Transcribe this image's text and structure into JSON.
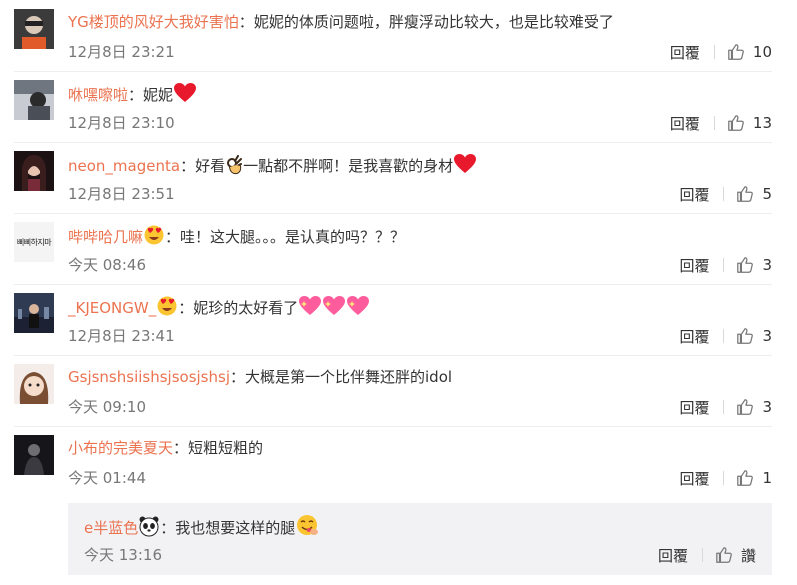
{
  "comments": [
    {
      "username": "YG楼顶的风好大我好害怕",
      "text": "妮妮的体质问题啦，胖瘦浮动比较大，也是比较难受了",
      "time": "12月8日 23:21",
      "reply_label": "回覆",
      "likes": "10"
    },
    {
      "username": "咻嘿嚓啦",
      "text": "妮妮",
      "time": "12月8日 23:10",
      "reply_label": "回覆",
      "likes": "13"
    },
    {
      "username": "neon_magenta",
      "text": "好看",
      "text2": "一點都不胖啊！是我喜歡的身材",
      "time": "12月8日 23:51",
      "reply_label": "回覆",
      "likes": "5"
    },
    {
      "username": "哔哔哈几嘛",
      "text": "哇！这大腿。。。是认真的吗？？？",
      "time": "今天 08:46",
      "reply_label": "回覆",
      "likes": "3"
    },
    {
      "username": "_KJEONGW_",
      "text": "妮珍的太好看了",
      "time": "12月8日 23:41",
      "reply_label": "回覆",
      "likes": "3"
    },
    {
      "username": "Gsjsnshsiishsjsosjshsj",
      "text": "大概是第一个比伴舞还胖的idol",
      "time": "今天 09:10",
      "reply_label": "回覆",
      "likes": "3"
    },
    {
      "username": "小布的完美夏天",
      "text": "短粗短粗的",
      "time": "今天 01:44",
      "reply_label": "回覆",
      "likes": "1"
    }
  ],
  "subreply": {
    "username": "e半蓝色",
    "text": "我也想要这样的腿",
    "time": "今天 13:16",
    "reply_label": "回覆",
    "like_label": "讚"
  },
  "avatar4_text": "삐삐하지마",
  "colon": "：",
  "colors": {
    "username": "#eb7350",
    "text": "#333333",
    "meta": "#777777",
    "subreply_bg": "#f2f2f5"
  },
  "icons": [
    "thumbs-up-icon",
    "red-heart-emoji",
    "ok-hand-emoji",
    "heart-eyes-emoji",
    "sparkling-heart-emoji",
    "panda-emoji",
    "yummy-face-emoji"
  ]
}
